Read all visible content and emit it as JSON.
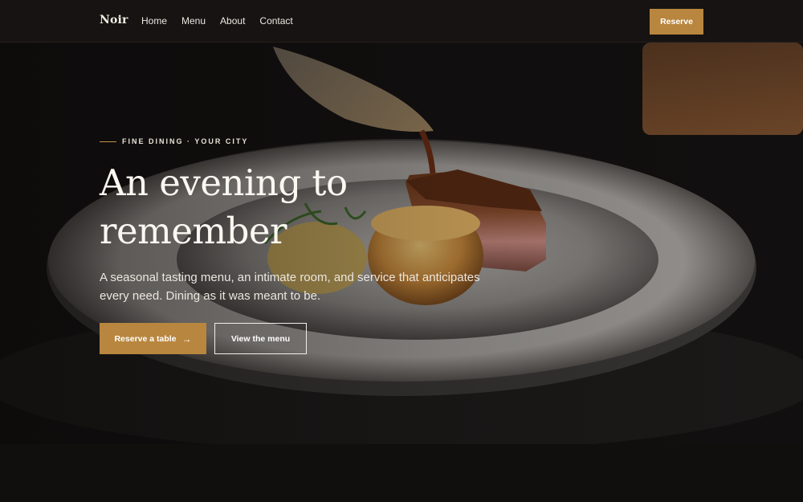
{
  "nav": {
    "brand": "Noir",
    "links": [
      "Home",
      "Menu",
      "About",
      "Contact"
    ],
    "reserve_label": "Reserve"
  },
  "hero": {
    "eyebrow": "FINE DINING · YOUR CITY",
    "headline_line1": "An evening to",
    "headline_line2": "remember",
    "subtext_line1": "A seasonal tasting menu, an intimate room, and service that anticipates",
    "subtext_line2": "every need. Dining as it was meant to be.",
    "primary_cta": "Reserve a table",
    "primary_cta_arrow": "→",
    "secondary_cta": "View the menu"
  },
  "colors": {
    "accent": "#b8863e",
    "nav_bg": "#161312",
    "page_bg": "#100e0d"
  }
}
